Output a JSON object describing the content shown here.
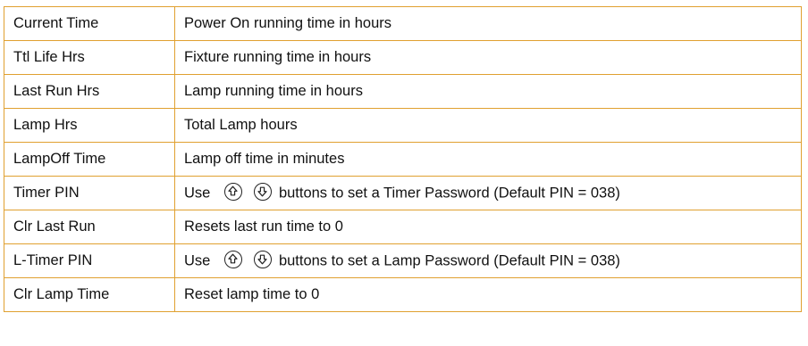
{
  "rows": [
    {
      "term": "Current Time",
      "desc": "Power On running time in hours"
    },
    {
      "term": "Ttl Life Hrs",
      "desc": "Fixture running time in hours"
    },
    {
      "term": "Last Run Hrs",
      "desc": "Lamp running time in hours"
    },
    {
      "term": "Lamp Hrs",
      "desc": "Total Lamp hours"
    },
    {
      "term": "LampOff Time",
      "desc": "Lamp off time in minutes"
    },
    {
      "term": "Timer PIN",
      "desc_prefix": "Use",
      "desc_suffix": "buttons to set a Timer Password (Default PIN = 038)",
      "icons": [
        "up-arrow-icon",
        "down-arrow-icon"
      ]
    },
    {
      "term": "Clr Last Run",
      "desc": "Resets last run time to 0"
    },
    {
      "term": "L-Timer PIN",
      "desc_prefix": "Use",
      "desc_suffix": "buttons to set a Lamp Password (Default PIN = 038)",
      "icons": [
        "up-arrow-icon",
        "down-arrow-icon"
      ]
    },
    {
      "term": "Clr Lamp Time",
      "desc": "Reset lamp time to 0"
    }
  ],
  "colors": {
    "border": "#e0a030",
    "text": "#111111"
  }
}
